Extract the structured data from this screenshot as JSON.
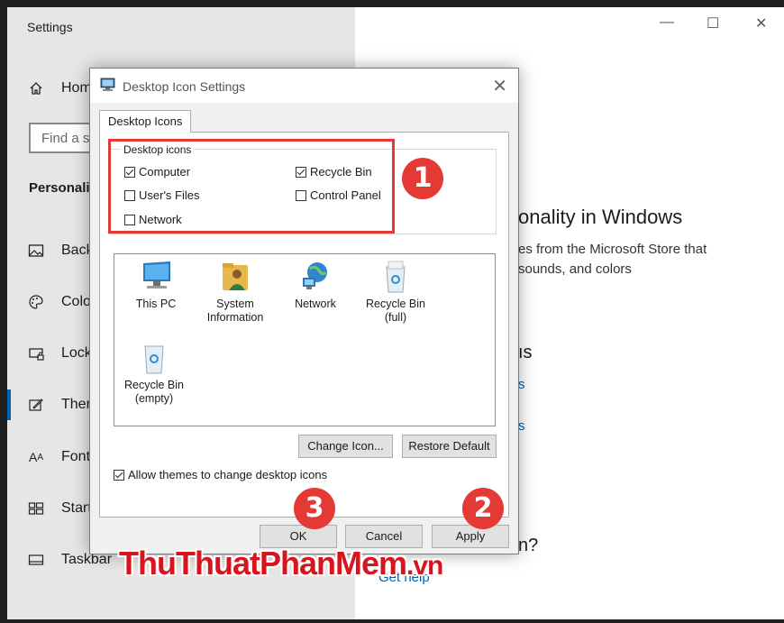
{
  "settings": {
    "window_title": "Settings",
    "home_label": "Hom",
    "search_placeholder": "Find a s",
    "section_heading": "Personali",
    "nav": [
      {
        "icon": "image-icon",
        "label": "Back"
      },
      {
        "icon": "palette-icon",
        "label": "Colo"
      },
      {
        "icon": "lock-screen-icon",
        "label": "Lock"
      },
      {
        "icon": "brush-icon",
        "label": "Ther"
      },
      {
        "icon": "font-icon",
        "label": "Font"
      },
      {
        "icon": "start-tiles-icon",
        "label": "Start"
      },
      {
        "icon": "taskbar-icon",
        "label": "Taskbar"
      }
    ],
    "content": {
      "heading": "onality in Windows",
      "desc_line1": "es from the Microsoft Store that",
      "desc_line2": "sounds, and colors",
      "subheading": "ıs",
      "link1": "s",
      "link2": "s",
      "question": "n?",
      "help_link": "Get help"
    }
  },
  "dialog": {
    "title": "Desktop Icon Settings",
    "tab_label": "Desktop Icons",
    "group_label": "Desktop icons",
    "checkboxes": [
      {
        "label": "Computer",
        "checked": true
      },
      {
        "label": "Recycle Bin",
        "checked": true
      },
      {
        "label": "User's Files",
        "checked": false
      },
      {
        "label": "Control Panel",
        "checked": false
      },
      {
        "label": "Network",
        "checked": false
      }
    ],
    "icons": [
      {
        "name": "this-pc-icon",
        "label": "This PC",
        "label2": ""
      },
      {
        "name": "system-information-icon",
        "label": "System",
        "label2": "Information"
      },
      {
        "name": "network-icon",
        "label": "Network",
        "label2": ""
      },
      {
        "name": "recycle-bin-full-icon",
        "label": "Recycle Bin",
        "label2": "(full)"
      },
      {
        "name": "recycle-bin-empty-icon",
        "label": "Recycle Bin",
        "label2": "(empty)"
      }
    ],
    "change_icon_button": "Change Icon...",
    "restore_default_button": "Restore Default",
    "allow_themes_label": "Allow themes to change desktop icons",
    "allow_themes_checked": true,
    "ok_button": "OK",
    "cancel_button": "Cancel",
    "apply_button": "Apply"
  },
  "annotations": {
    "badge1": "1",
    "badge2": "2",
    "badge3": "3"
  },
  "watermark": {
    "main": "ThuThuatPhanMem",
    "suffix": ".vn"
  },
  "colors": {
    "accent": "#0063b1",
    "annotation_red": "#e53935",
    "watermark_red": "#d8141e"
  }
}
